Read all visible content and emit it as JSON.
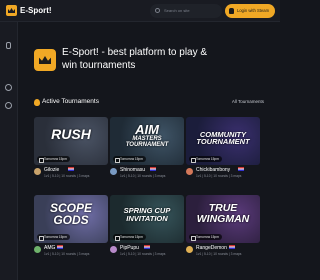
{
  "header": {
    "brand": "E-Sport!",
    "search_placeholder": "Search on site",
    "login_label": "Login with Steam"
  },
  "hero": {
    "title": "E-Sport! - best platform to play & win tournaments"
  },
  "tournaments": {
    "section_title": "Active Tournaments",
    "all_link": "All Tournaments",
    "cards": [
      {
        "title_line1": "RUSH",
        "title_line2": "",
        "date": "Tomorrow 15pm",
        "name": "Gilozie",
        "info": "1v1 | 5-10 | 10 rounds | 3 maps",
        "bg": "#2a2f3a",
        "accent": "#4a5364"
      },
      {
        "title_line1": "AIM",
        "title_line2": "MASTERS",
        "title_line3": "TOURNAMENT",
        "date": "Tomorrow 15pm",
        "name": "Shinomasu",
        "info": "1v1 | 5-10 | 10 rounds | 3 maps",
        "bg": "#1f2b36",
        "accent": "#3f5466"
      },
      {
        "title_line1": "COMMUNITY",
        "title_line2": "TOURNAMENT",
        "date": "Tomorrow 15pm",
        "name": "Chickibambony",
        "info": "1v1 | 5-10 | 10 rounds | 3 maps",
        "bg": "#1b1d3b",
        "accent": "#3a2f6e"
      },
      {
        "title_line1": "SCOPE",
        "title_line2": "GODS",
        "date": "Tomorrow 15pm",
        "name": "AMG",
        "info": "1v1 | 5-10 | 10 rounds | 3 maps",
        "bg": "#3a3f58",
        "accent": "#6f6da6"
      },
      {
        "title_line1": "SPRING CUP",
        "title_line2": "INVITATION",
        "date": "Tomorrow 15pm",
        "name": "PipPupu",
        "info": "1v1 | 5-10 | 10 rounds | 3 maps",
        "bg": "#1c2a2e",
        "accent": "#36545a"
      },
      {
        "title_line1": "TRUE",
        "title_line2": "WINGMAN",
        "date": "Tomorrow 15pm",
        "name": "RangeDemon",
        "info": "1v1 | 5-10 | 10 rounds | 3 maps",
        "bg": "#2c1f3d",
        "accent": "#5a3a7a"
      }
    ]
  },
  "colors": {
    "accent": "#f0a825",
    "background": "#14161c",
    "panel": "#191b22"
  }
}
